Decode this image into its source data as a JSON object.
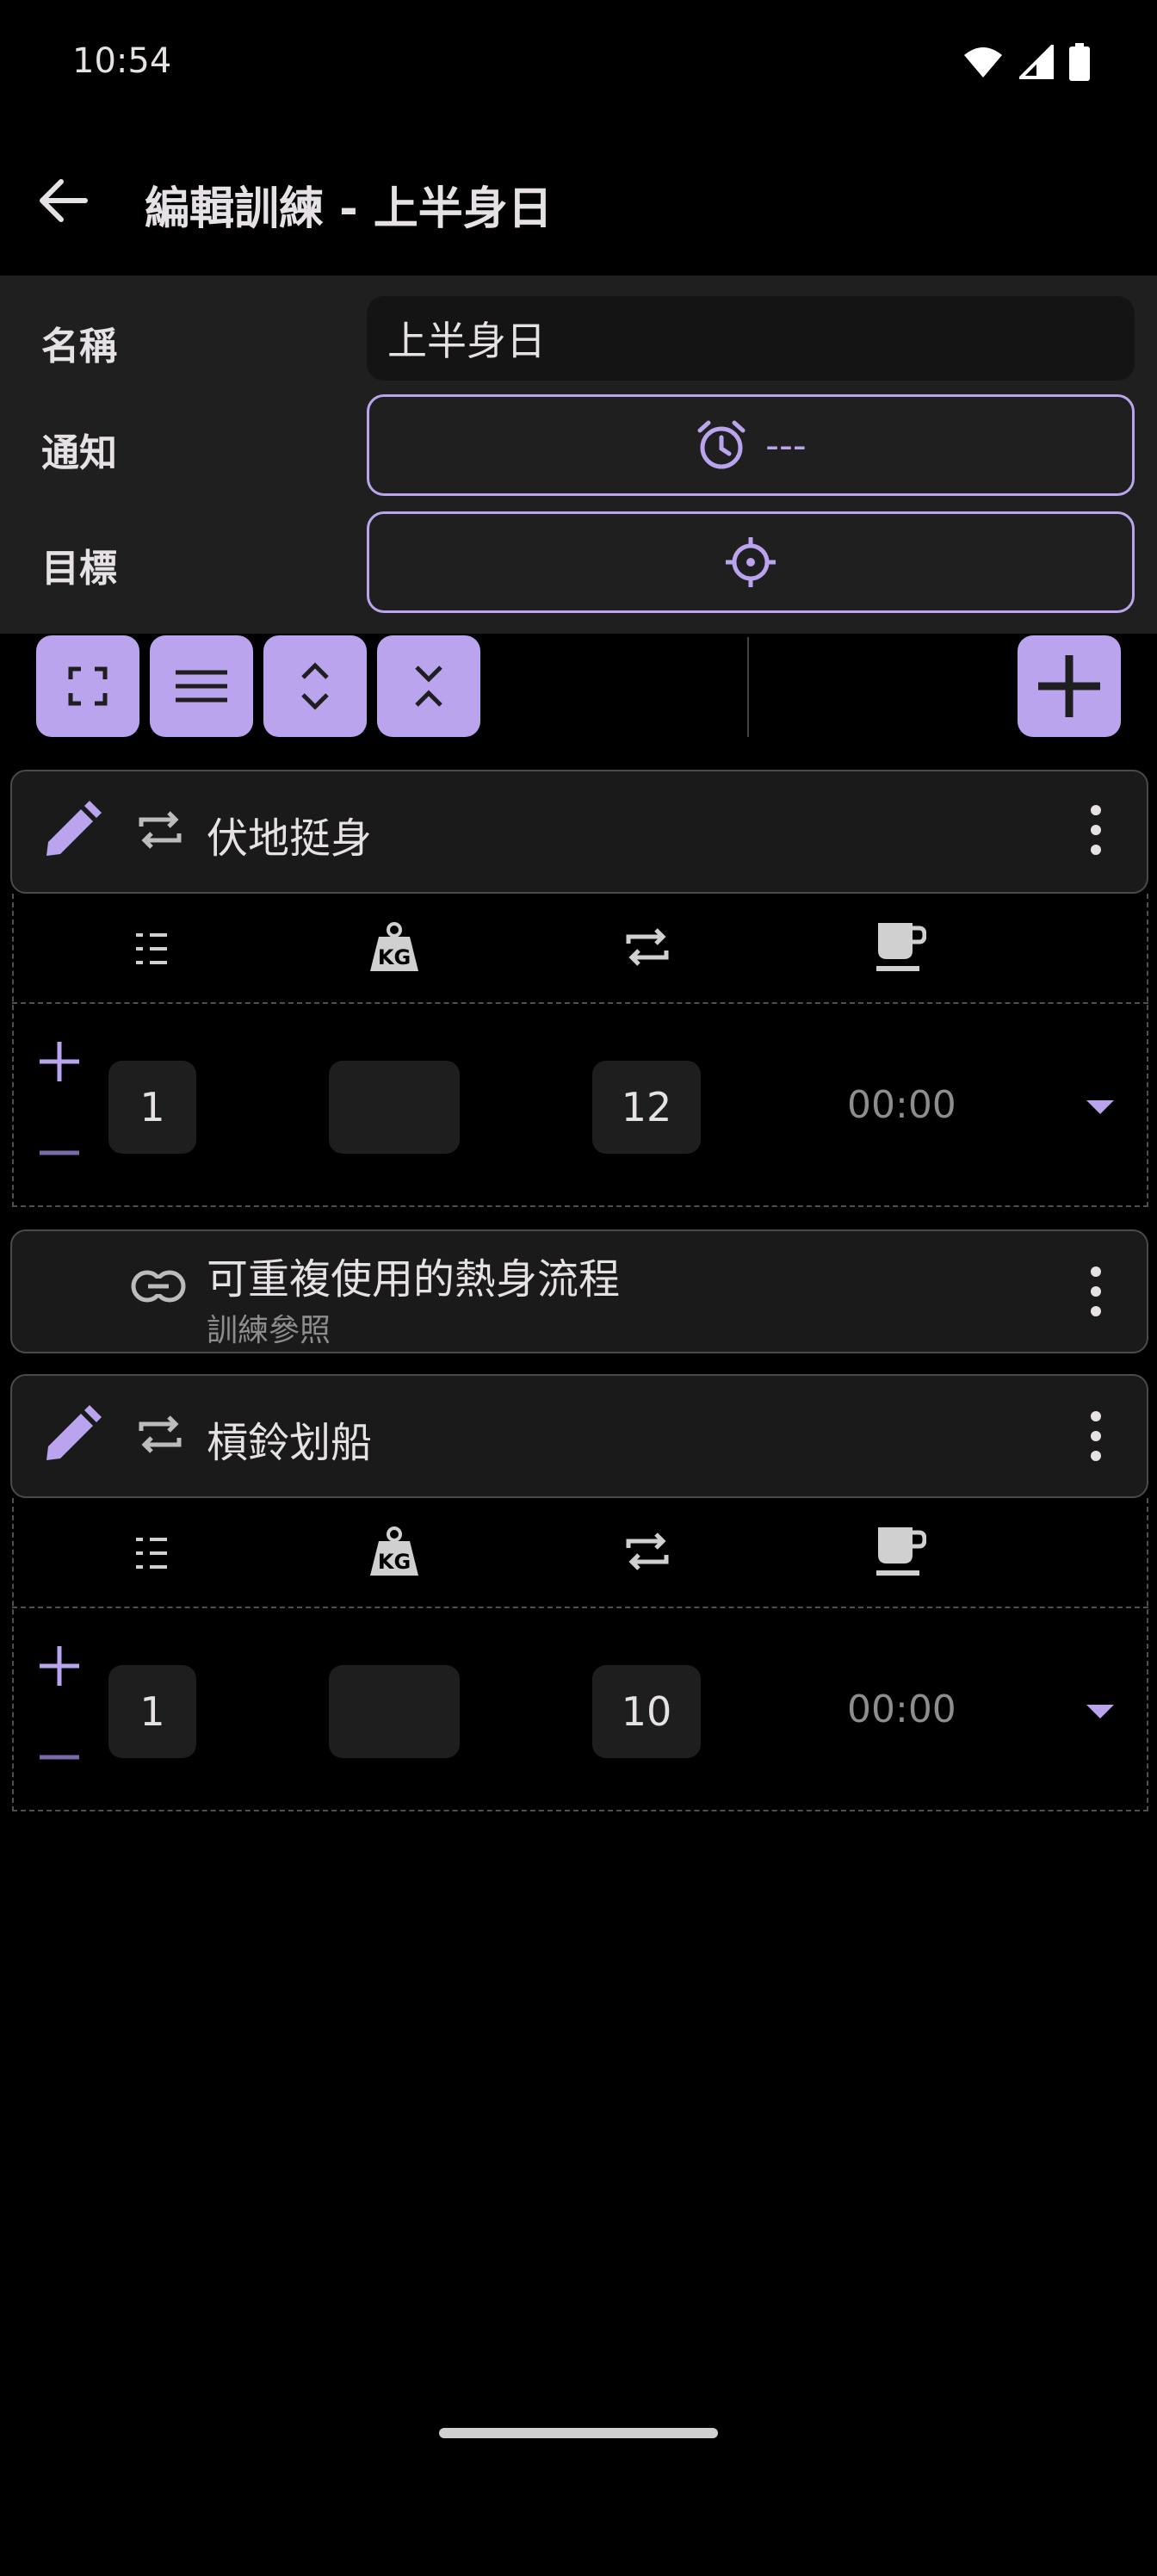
{
  "status_bar": {
    "time": "10:54",
    "icons": [
      "wifi-icon",
      "signal-icon",
      "battery-icon"
    ]
  },
  "app_bar": {
    "title": "編輯訓練 - 上半身日"
  },
  "form": {
    "name_label": "名稱",
    "name_value": "上半身日",
    "notify_label": "通知",
    "notify_value": "---",
    "target_label": "目標"
  },
  "toolbar": {
    "buttons": [
      "fullscreen-icon",
      "menu-lines-icon",
      "expand-icon",
      "collapse-icon"
    ],
    "add_button": "add-icon"
  },
  "exercises": [
    {
      "title": "伏地挺身",
      "column_icons": [
        "list-icon",
        "weight-kg-icon",
        "repeat-icon",
        "rest-cup-icon"
      ],
      "set": {
        "count": "1",
        "weight": "",
        "reps": "12",
        "rest": "00:00"
      }
    },
    {
      "title": "可重複使用的熱身流程",
      "subtitle": "訓練參照"
    },
    {
      "title": "槓鈴划船",
      "column_icons": [
        "list-icon",
        "weight-kg-icon",
        "repeat-icon",
        "rest-cup-icon"
      ],
      "set": {
        "count": "1",
        "weight": "",
        "reps": "10",
        "rest": "00:00"
      }
    }
  ],
  "colors": {
    "accent": "#b9a4ed",
    "background": "#000000",
    "panel": "#1f1f1f",
    "card": "#1a1a1a"
  }
}
